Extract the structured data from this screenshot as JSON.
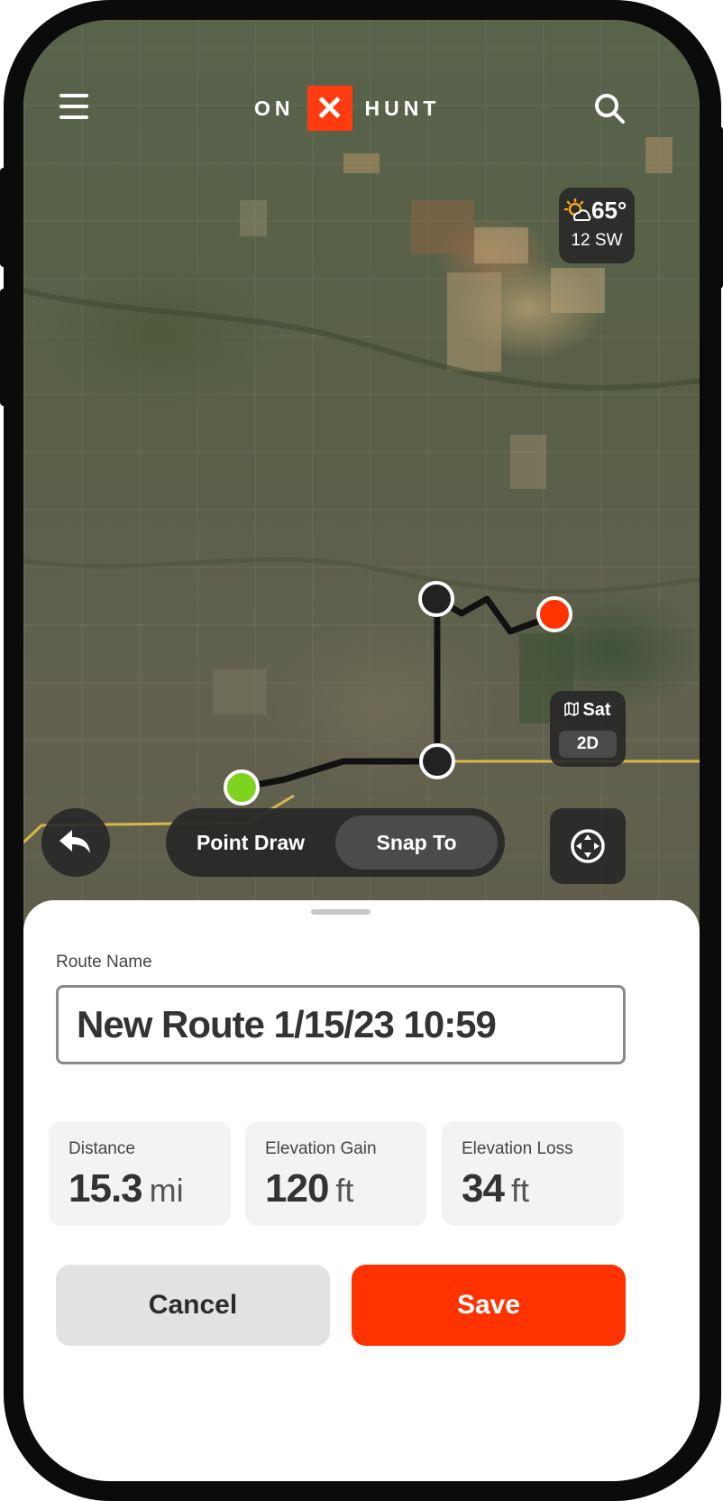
{
  "app": {
    "logo_left": "ON",
    "logo_mark": "✕",
    "logo_right": "HUNT"
  },
  "weather": {
    "temperature": "65°",
    "wind": "12 SW"
  },
  "layer_toggle": {
    "map_type": "Sat",
    "view_mode": "2D"
  },
  "draw_mode": {
    "options": [
      "Point Draw",
      "Snap To"
    ],
    "selected": "Snap To"
  },
  "sheet": {
    "route_name_label": "Route Name",
    "route_name_value": "New Route 1/15/23 10:59",
    "stats": [
      {
        "label": "Distance",
        "value": "15.3",
        "unit": "mi"
      },
      {
        "label": "Elevation Gain",
        "value": "120",
        "unit": "ft"
      },
      {
        "label": "Elevation Loss",
        "value": "34",
        "unit": "ft"
      }
    ],
    "cancel_label": "Cancel",
    "save_label": "Save"
  },
  "colors": {
    "brand": "#ff3b0f",
    "start_marker": "#7ed321",
    "end_marker": "#ff3300",
    "waypoint_marker": "#222222",
    "road": "#d8b84a"
  },
  "icons": {
    "menu": "hamburger-menu-icon",
    "search": "search-icon",
    "weather": "partly-sunny-icon",
    "layers": "map-icon",
    "back": "undo-icon",
    "recenter": "locate-crosshair-icon"
  }
}
